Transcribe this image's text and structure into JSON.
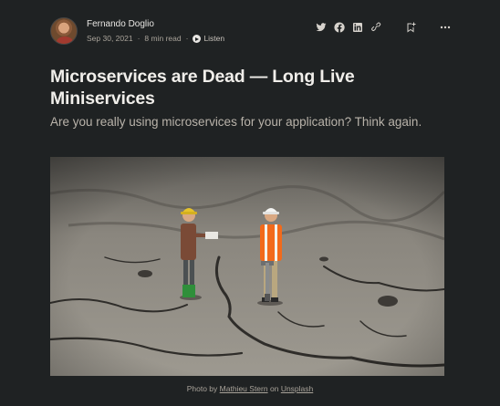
{
  "author": {
    "name": "Fernando Doglio",
    "date": "Sep 30, 2021",
    "read_time": "8 min read",
    "listen_label": "Listen"
  },
  "actions": {
    "icons": [
      "twitter-icon",
      "facebook-icon",
      "linkedin-icon",
      "link-icon",
      "bookmark-add-icon",
      "more-options-icon"
    ]
  },
  "article": {
    "title": "Microservices are Dead — Long Live Miniservices",
    "subtitle": "Are you really using microservices for your application? Think again."
  },
  "photo_caption": {
    "prefix": "Photo by",
    "photographer": "Mathieu Stern",
    "on": "on",
    "source": "Unsplash"
  },
  "colors": {
    "background": "#1f2223",
    "text": "#e8e6e3",
    "muted": "#a9a39a"
  }
}
